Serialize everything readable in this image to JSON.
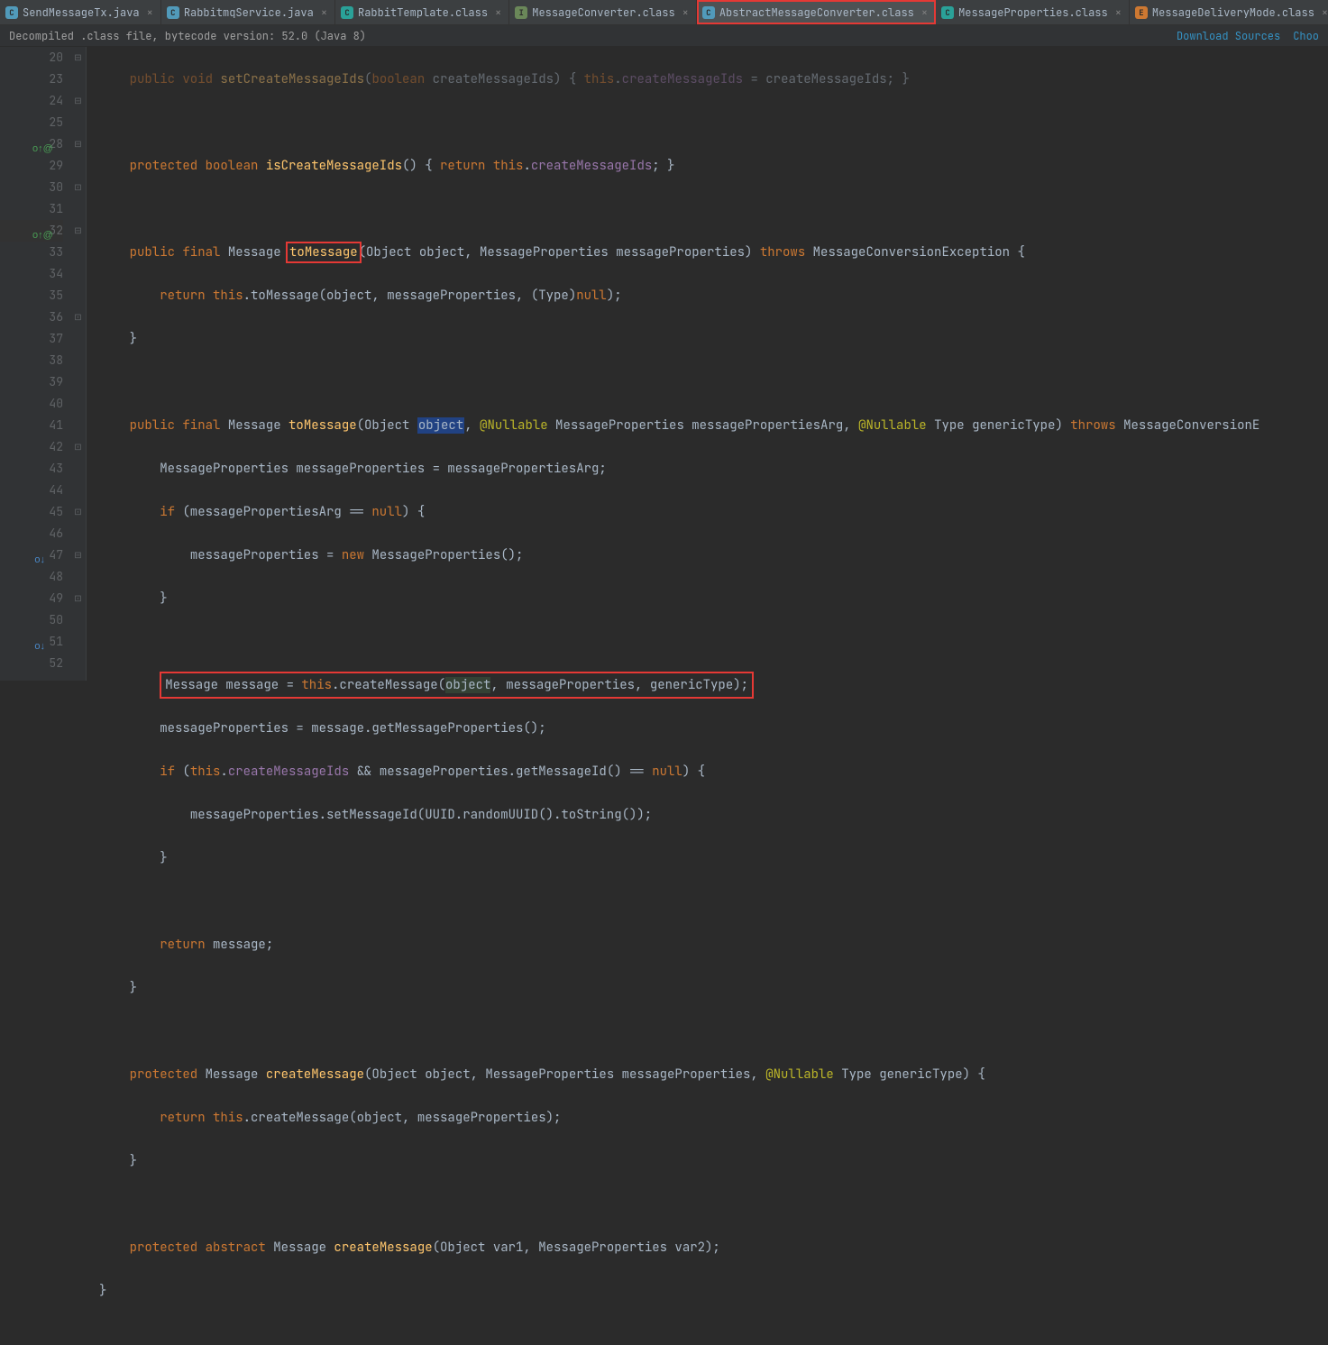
{
  "tabs": [
    {
      "icon": "java",
      "label": "SendMessageTx.java"
    },
    {
      "icon": "java",
      "label": "RabbitmqService.java"
    },
    {
      "icon": "teal",
      "label": "RabbitTemplate.class"
    },
    {
      "icon": "green",
      "label": "MessageConverter.class"
    },
    {
      "icon": "java",
      "label": "AbstractMessageConverter.class"
    },
    {
      "icon": "teal",
      "label": "MessageProperties.class"
    },
    {
      "icon": "orange",
      "label": "MessageDeliveryMode.class"
    }
  ],
  "info": {
    "left": "Decompiled .class file, bytecode version: 52.0 (Java 8)",
    "link1": "Download Sources",
    "link2": "Choo"
  },
  "gutter_lines": [
    "20",
    "23",
    "24",
    "25",
    "28",
    "29",
    "30",
    "31",
    "32",
    "33",
    "34",
    "35",
    "36",
    "37",
    "38",
    "39",
    "40",
    "41",
    "42",
    "43",
    "44",
    "45",
    "46",
    "47",
    "48",
    "49",
    "50",
    "51",
    "52"
  ],
  "code": {
    "l20_a": "public void ",
    "l20_m": "setCreateMessageIds",
    "l20_b": "(",
    "l20_t1": "boolean ",
    "l20_p": "createMessageIds",
    "l20_c": ") { ",
    "l20_th": "this",
    "l20_d": ".",
    "l20_f": "createMessageIds",
    "l20_e": " = createMessageIds; }",
    "l24_a": "protected boolean ",
    "l24_m": "isCreateMessageIds",
    "l24_b": "() { ",
    "l24_r": "return ",
    "l24_th": "this",
    "l24_d": ".",
    "l24_f": "createMessageIds",
    "l24_e": "; }",
    "l28_a": "public final ",
    "l28_t": "Message ",
    "l28_m": "toMessage",
    "l28_b": "(Object object, MessageProperties messageProperties) ",
    "l28_th": "throws ",
    "l28_ex": "MessageConversionException {",
    "l29_a": "return ",
    "l29_th": "this",
    "l29_b": ".toMessage(object, messageProperties, (Type)",
    "l29_n": "null",
    "l29_c": ");",
    "l30": "}",
    "l32_a": "public final ",
    "l32_t": "Message ",
    "l32_m": "toMessage",
    "l32_b": "(Object ",
    "l32_obj": "object",
    "l32_c": ", ",
    "l32_an": "@Nullable",
    "l32_d": " MessageProperties messagePropertiesArg, ",
    "l32_an2": "@Nullable",
    "l32_e": " Type genericType) ",
    "l32_th": "throws ",
    "l32_ex": "MessageConversionE",
    "l33": "MessageProperties messageProperties = messagePropertiesArg;",
    "l34_a": "if ",
    "l34_b": "(messagePropertiesArg == ",
    "l34_n": "null",
    "l34_c": ") {",
    "l35_a": "messageProperties = ",
    "l35_n": "new ",
    "l35_b": "MessageProperties();",
    "l36": "}",
    "l38_a": "Message message = ",
    "l38_th": "this",
    "l38_b": ".createMessage(",
    "l38_obj": "object",
    "l38_c": ", messageProperties, genericType);",
    "l39": "messageProperties = message.getMessageProperties();",
    "l40_a": "if ",
    "l40_b": "(",
    "l40_th": "this",
    "l40_c": ".",
    "l40_f": "createMessageIds",
    "l40_d": " && messageProperties.getMessageId() == ",
    "l40_n": "null",
    "l40_e": ") {",
    "l41": "messageProperties.setMessageId(UUID.randomUUID().toString());",
    "l42": "}",
    "l44_a": "return ",
    "l44_b": "message;",
    "l45": "}",
    "l47_a": "protected ",
    "l47_t": "Message ",
    "l47_m": "createMessage",
    "l47_b": "(Object object, MessageProperties messageProperties, ",
    "l47_an": "@Nullable",
    "l47_c": " Type genericType) {",
    "l48_a": "return ",
    "l48_th": "this",
    "l48_b": ".createMessage(object, messageProperties);",
    "l49": "}",
    "l51_a": "protected abstract ",
    "l51_t": "Message ",
    "l51_m": "createMessage",
    "l51_b": "(Object var1, MessageProperties var2);",
    "l52": "}"
  }
}
